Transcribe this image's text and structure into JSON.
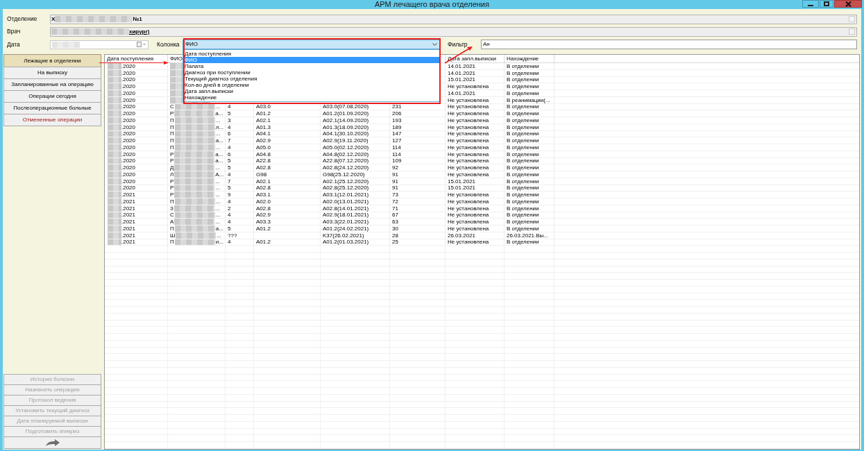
{
  "window": {
    "title": "АРМ лечащего врача отделения"
  },
  "form": {
    "department_label": "Отделение",
    "department_start": "Х",
    "department_end": "№1",
    "doctor_label": "Врач",
    "doctor_end": "хирург)",
    "date_label": "Дата",
    "column_label": "Колонка",
    "filter_label": "Фильтр",
    "filter_value": "Ан"
  },
  "column_select": {
    "value": "ФИО",
    "expanded": true,
    "options": [
      {
        "label": "Дата поступления",
        "selected": false
      },
      {
        "label": "ФИО",
        "selected": true
      },
      {
        "label": "Палата",
        "selected": false
      },
      {
        "label": "Диагноз при поступлении",
        "selected": false
      },
      {
        "label": "Текущий диагноз отделения",
        "selected": false
      },
      {
        "label": "Кол-во дней в отделении",
        "selected": false
      },
      {
        "label": "Дата запл.выписки",
        "selected": false
      },
      {
        "label": "Нахождение",
        "selected": false
      }
    ]
  },
  "sidebar": {
    "top": [
      {
        "label": "Лежащие в отделении",
        "selected": true,
        "kind": "normal"
      },
      {
        "label": "На выписку",
        "selected": false,
        "kind": "normal"
      },
      {
        "label": "Запланированные на операцию",
        "selected": false,
        "kind": "normal"
      },
      {
        "label": "Операции сегодня",
        "selected": false,
        "kind": "normal"
      },
      {
        "label": "Послеоперационные больные",
        "selected": false,
        "kind": "normal"
      },
      {
        "label": "Отмененные операции",
        "selected": false,
        "kind": "cancelled"
      }
    ],
    "bottom": [
      {
        "label": "История болезни",
        "disabled": true
      },
      {
        "label": "Назначить операцию",
        "disabled": true
      },
      {
        "label": "Протокол ведения",
        "disabled": true
      },
      {
        "label": "Установить текущий диагноз",
        "disabled": true
      },
      {
        "label": "Дата планируемой выписки",
        "disabled": true
      },
      {
        "label": "Подготовить эпикриз",
        "disabled": true
      }
    ]
  },
  "table": {
    "columns_left": [
      "Дата поступления",
      "ФИО"
    ],
    "columns_right": [
      "Дата запл.выписки",
      "Нахождение"
    ],
    "rows": [
      {
        "admitted": ".2020",
        "discharge": "14.01.2021",
        "location": "В отделении"
      },
      {
        "admitted": ".2020",
        "discharge": "14.01.2021",
        "location": "В отделении"
      },
      {
        "admitted": ".2020",
        "discharge": "15.01.2021",
        "location": "В отделении"
      },
      {
        "admitted": ".2020",
        "discharge": "Не установлена",
        "location": "В отделении"
      },
      {
        "admitted": ".2020",
        "discharge": "14.01.2021",
        "location": "В отделении"
      },
      {
        "admitted": ".2020",
        "discharge": "Не установлена",
        "location": "В реанимации(..."
      },
      {
        "admitted": ".2020",
        "fio": "С",
        "fio_tail": "...",
        "ward": "4",
        "diag_in": "A03.0",
        "diag_cur": "A03.0(07.08.2020)",
        "days": "231",
        "discharge": "Не установлена",
        "location": "В отделении"
      },
      {
        "admitted": ".2020",
        "fio": "Р",
        "fio_tail": "а...",
        "ward": "5",
        "diag_in": "A01.2",
        "diag_cur": "A01.2(01.09.2020)",
        "days": "206",
        "discharge": "Не установлена",
        "location": "В отделении"
      },
      {
        "admitted": ".2020",
        "fio": "П",
        "fio_tail": "...",
        "ward": "3",
        "diag_in": "A02.1",
        "diag_cur": "A02.1(14.09.2020)",
        "days": "193",
        "discharge": "Не установлена",
        "location": "В отделении"
      },
      {
        "admitted": ".2020",
        "fio": "П",
        "fio_tail": "л...",
        "ward": "4",
        "diag_in": "A01.3",
        "diag_cur": "A01.3(18.09.2020)",
        "days": "189",
        "discharge": "Не установлена",
        "location": "В отделении"
      },
      {
        "admitted": ".2020",
        "fio": "П",
        "fio_tail": "...",
        "ward": "6",
        "diag_in": "A04.1",
        "diag_cur": "A04.1(30.10.2020)",
        "days": "147",
        "discharge": "Не установлена",
        "location": "В отделении"
      },
      {
        "admitted": ".2020",
        "fio": "П",
        "fio_tail": "а...",
        "ward": "7",
        "diag_in": "A02.9",
        "diag_cur": "A02.9(19.11.2020)",
        "days": "127",
        "discharge": "Не установлена",
        "location": "В отделении"
      },
      {
        "admitted": ".2020",
        "fio": "П",
        "fio_tail": "...",
        "ward": "4",
        "diag_in": "A05.0",
        "diag_cur": "A05.0(02.12.2020)",
        "days": "114",
        "discharge": "Не установлена",
        "location": "В отделении"
      },
      {
        "admitted": ".2020",
        "fio": "Р",
        "fio_tail": "а...",
        "ward": "6",
        "diag_in": "A04.8",
        "diag_cur": "A04.8(02.12.2020)",
        "days": "114",
        "discharge": "Не установлена",
        "location": "В отделении"
      },
      {
        "admitted": ".2020",
        "fio": "Р",
        "fio_tail": "а...",
        "ward": "5",
        "diag_in": "A22.8",
        "diag_cur": "A22.8(07.12.2020)",
        "days": "109",
        "discharge": "Не установлена",
        "location": "В отделении"
      },
      {
        "admitted": ".2020",
        "fio": "Д",
        "fio_tail": "...",
        "ward": "5",
        "diag_in": "A02.8",
        "diag_cur": "A02.8(24.12.2020)",
        "days": "92",
        "discharge": "Не установлена",
        "location": "В отделении"
      },
      {
        "admitted": ".2020",
        "fio": "Л",
        "fio_tail": "А...",
        "ward": "4",
        "diag_in": "G98",
        "diag_cur": "G98(25.12.2020)",
        "days": "91",
        "discharge": "Не установлена",
        "location": "В отделении"
      },
      {
        "admitted": ".2020",
        "fio": "Р",
        "fio_tail": "...",
        "ward": "7",
        "diag_in": "A02.1",
        "diag_cur": "A02.1(25.12.2020)",
        "days": "91",
        "discharge": "15.01.2021",
        "location": "В отделении"
      },
      {
        "admitted": ".2020",
        "fio": "Р",
        "fio_tail": "...",
        "ward": "5",
        "diag_in": "A02.8",
        "diag_cur": "A02.8(25.12.2020)",
        "days": "91",
        "discharge": "15.01.2021",
        "location": "В отделении"
      },
      {
        "admitted": ".2021",
        "fio": "Р",
        "fio_tail": "...",
        "ward": "9",
        "diag_in": "A03.1",
        "diag_cur": "A03.1(12.01.2021)",
        "days": "73",
        "discharge": "Не установлена",
        "location": "В отделении"
      },
      {
        "admitted": ".2021",
        "fio": "П",
        "fio_tail": "...",
        "ward": "4",
        "diag_in": "A02.0",
        "diag_cur": "A02.0(13.01.2021)",
        "days": "72",
        "discharge": "Не установлена",
        "location": "В отделении"
      },
      {
        "admitted": ".2021",
        "fio": "З",
        "fio_tail": "...",
        "ward": "2",
        "diag_in": "A02.8",
        "diag_cur": "A02.8(14.01.2021)",
        "days": "71",
        "discharge": "Не установлена",
        "location": "В отделении"
      },
      {
        "admitted": ".2021",
        "fio": "С",
        "fio_tail": "...",
        "ward": "4",
        "diag_in": "A02.9",
        "diag_cur": "A02.9(18.01.2021)",
        "days": "67",
        "discharge": "Не установлена",
        "location": "В отделении"
      },
      {
        "admitted": ".2021",
        "fio": "А",
        "fio_tail": "...",
        "ward": "4",
        "diag_in": "A03.3",
        "diag_cur": "A03.3(22.01.2021)",
        "days": "63",
        "discharge": "Не установлена",
        "location": "В отделении"
      },
      {
        "admitted": ".2021",
        "fio": "П",
        "fio_tail": "а...",
        "ward": "5",
        "diag_in": "A01.2",
        "diag_cur": "A01.2(24.02.2021)",
        "days": "30",
        "discharge": "Не установлена",
        "location": "В отделении"
      },
      {
        "admitted": ".2021",
        "fio": "Ш",
        "fio_tail": "...",
        "ward": "???",
        "diag_cur": "K37(26.02.2021)",
        "days": "28",
        "discharge": "26.03.2021",
        "location": "26.03.2021.Вы..."
      },
      {
        "admitted": ".2021",
        "fio": "П",
        "fio_tail": "и...",
        "ward": "4",
        "diag_in": "A01.2",
        "diag_cur": "A01.2(01.03.2021)",
        "days": "25",
        "discharge": "Не установлена",
        "location": "В отделении"
      }
    ]
  }
}
